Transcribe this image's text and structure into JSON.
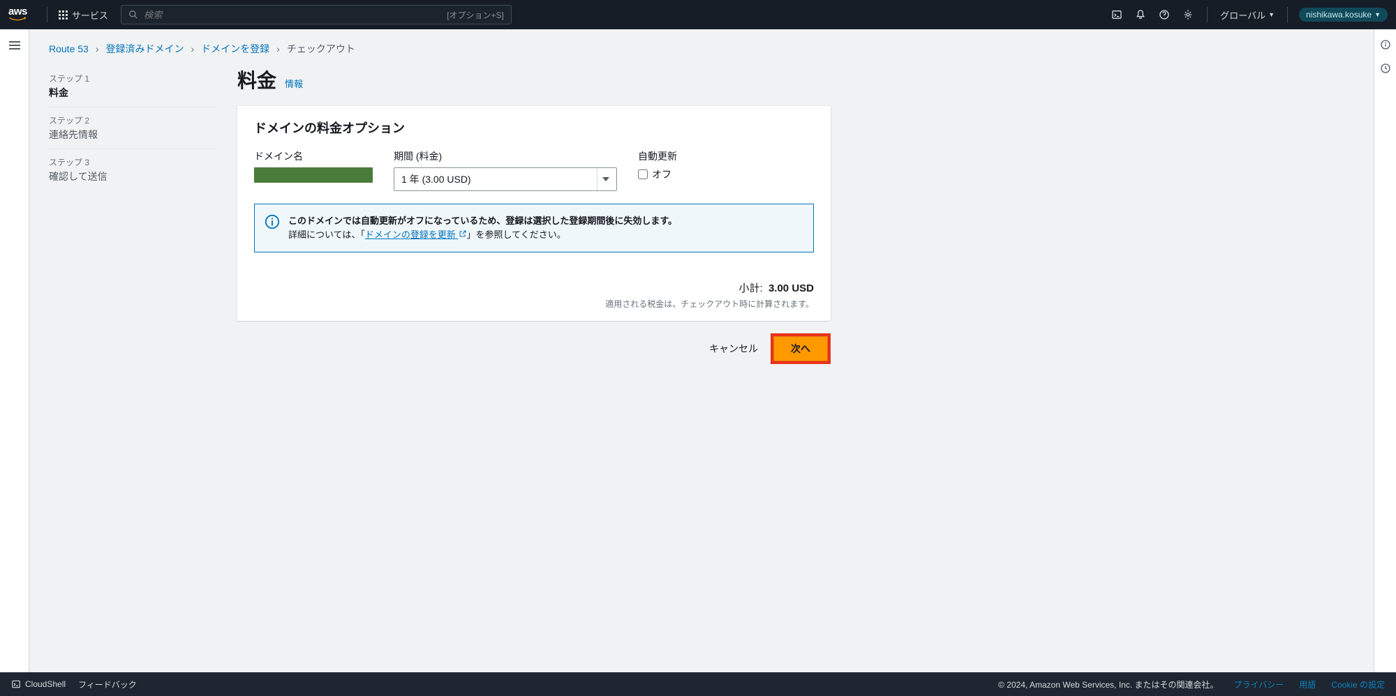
{
  "nav": {
    "services_label": "サービス",
    "search_placeholder": "検索",
    "search_hint": "[オプション+S]",
    "region_label": "グローバル",
    "user_label": "nishikawa.kosuke"
  },
  "breadcrumb": {
    "items": [
      {
        "label": "Route 53",
        "link": true
      },
      {
        "label": "登録済みドメイン",
        "link": true
      },
      {
        "label": "ドメインを登録",
        "link": true
      },
      {
        "label": "チェックアウト",
        "link": false
      }
    ]
  },
  "wizard": {
    "steps": [
      {
        "label": "ステップ 1",
        "title": "料金",
        "active": true
      },
      {
        "label": "ステップ 2",
        "title": "連絡先情報",
        "active": false
      },
      {
        "label": "ステップ 3",
        "title": "確認して送信",
        "active": false
      }
    ]
  },
  "page": {
    "title": "料金",
    "info_link": "情報"
  },
  "panel": {
    "header": "ドメインの料金オプション",
    "domain_label": "ドメイン名",
    "period_label": "期間 (料金)",
    "period_value": "1 年 (3.00 USD)",
    "autorenew_label": "自動更新",
    "autorenew_off_label": "オフ"
  },
  "alert": {
    "strong": "このドメインでは自動更新がオフになっているため、登録は選択した登録期間後に失効します。",
    "before_link": "詳細については、「",
    "link": "ドメインの登録を更新",
    "after_link": "」を参照してください。"
  },
  "totals": {
    "subtotal_label": "小計:",
    "subtotal_value": "3.00 USD",
    "tax_note": "適用される税金は、チェックアウト時に計算されます。"
  },
  "actions": {
    "cancel": "キャンセル",
    "next": "次へ"
  },
  "footer": {
    "cloudshell": "CloudShell",
    "feedback": "フィードバック",
    "copyright": "© 2024, Amazon Web Services, Inc. またはその関連会社。",
    "privacy": "プライバシー",
    "terms": "用語",
    "cookie": "Cookie の設定"
  }
}
